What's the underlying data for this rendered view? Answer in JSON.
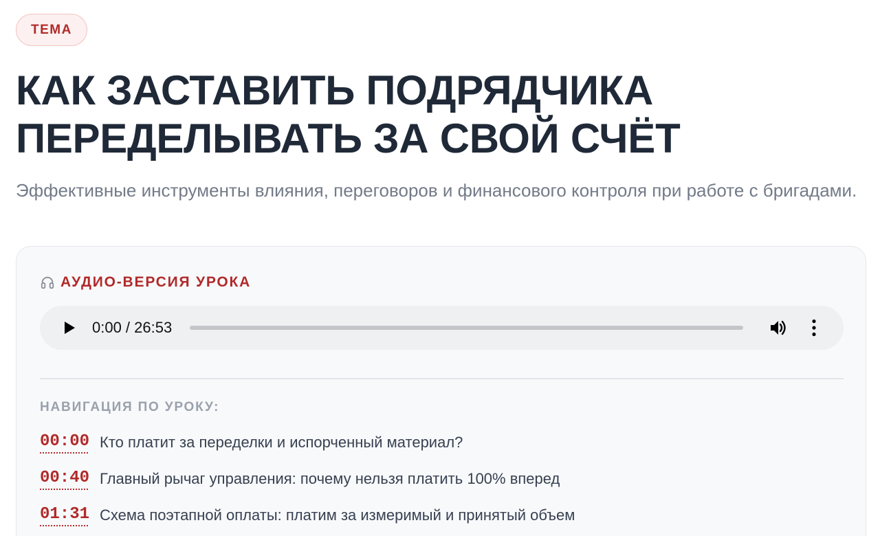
{
  "tag": "ТЕМА",
  "title_line1": "КАК ЗАСТАВИТЬ ПОДРЯДЧИКА",
  "title_line2": "ПЕРЕДЕЛЫВАТЬ ЗА СВОЙ СЧЁТ",
  "subtitle": "Эффективные инструменты влияния, переговоров и финансового контроля при работе с бригадами.",
  "audio": {
    "heading": "АУДИО-ВЕРСИЯ УРОКА",
    "heading_icon": "headphones-icon",
    "time_display": "0:00 / 26:53",
    "progress_fraction": 0
  },
  "navigation": {
    "title": "НАВИГАЦИЯ ПО УРОКУ:",
    "chapters": [
      {
        "time": "00:00",
        "text": "Кто платит за переделки и испорченный материал?"
      },
      {
        "time": "00:40",
        "text": "Главный рычаг управления: почему нельзя платить 100% вперед"
      },
      {
        "time": "01:31",
        "text": "Схема поэтапной оплаты: платим за измеримый и принятый объем"
      }
    ]
  },
  "colors": {
    "accent": "#b12a2a",
    "title": "#1f2937",
    "muted": "#737b88"
  }
}
